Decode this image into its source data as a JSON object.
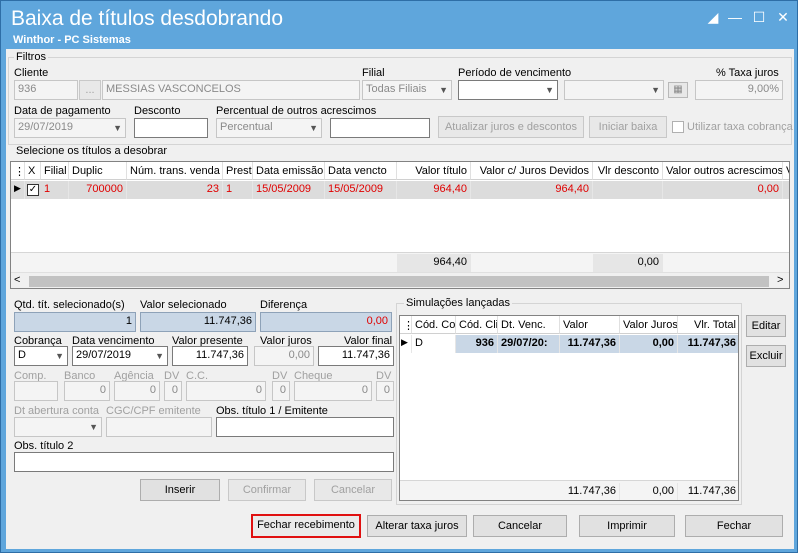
{
  "window": {
    "title": "Baixa de títulos desdobrando",
    "subtitle": "Winthor - PC Sistemas"
  },
  "filtros": {
    "group_label": "Filtros",
    "cliente_label": "Cliente",
    "cliente_code": "936",
    "cliente_lookup": "...",
    "cliente_name": "MESSIAS VASCONCELOS",
    "filial_label": "Filial",
    "filial_value": "Todas Filiais",
    "periodo_label": "Período de vencimento",
    "periodo_start": "",
    "periodo_end": "",
    "taxa_label": "% Taxa juros",
    "taxa_value": "9,00%",
    "data_pagamento_label": "Data de pagamento",
    "data_pagamento_value": "29/07/2019",
    "desconto_label": "Desconto",
    "desconto_value": "",
    "perc_outros_label": "Percentual de outros acrescimos",
    "perc_outros_select": "Percentual",
    "perc_outros_value": "",
    "atualizar_button": "Atualizar juros e descontos",
    "iniciar_button": "Iniciar baixa",
    "utilizar_taxa_label": "Utilizar taxa cobrança"
  },
  "titulos": {
    "group_label": "Selecione os títulos a desobrar",
    "columns": [
      "X",
      "Filial",
      "Duplic",
      "Núm. trans. venda",
      "Prest",
      "Data emissão",
      "Data vencto",
      "Valor título",
      "Valor c/ Juros Devidos",
      "Vlr desconto",
      "Valor outros acrescimos",
      "V"
    ],
    "rows": [
      {
        "filial": "1",
        "duplic": "700000",
        "num_trans": "23",
        "prest": "1",
        "data_emissao": "15/05/2009",
        "data_vencto": "15/05/2009",
        "valor_titulo": "964,40",
        "valor_juros": "964,40",
        "vlr_desconto": "",
        "valor_outros": "0,00"
      }
    ],
    "footer_valor_titulo": "964,40",
    "footer_vlr_desconto": "0,00"
  },
  "resumo": {
    "qtd_label": "Qtd. tít. selecionado(s)",
    "qtd_value": "1",
    "valor_sel_label": "Valor selecionado",
    "valor_sel_value": "11.747,36",
    "diferenca_label": "Diferença",
    "diferenca_value": "0,00"
  },
  "form": {
    "cobranca_label": "Cobrança",
    "cobranca_value": "D",
    "data_venc_label": "Data vencimento",
    "data_venc_value": "29/07/2019",
    "valor_presente_label": "Valor presente",
    "valor_presente_value": "11.747,36",
    "valor_juros_label": "Valor juros",
    "valor_juros_value": "0,00",
    "valor_final_label": "Valor final",
    "valor_final_value": "11.747,36",
    "comp_label": "Comp.",
    "banco_label": "Banco",
    "banco_value": "0",
    "agencia_label": "Agência",
    "agencia_value": "0",
    "dv_label": "DV",
    "dv1_value": "0",
    "cc_label": "C.C.",
    "cc_value": "0",
    "dv2_value": "0",
    "cheque_label": "Cheque",
    "cheque_value": "0",
    "dv3_value": "0",
    "dt_abertura_label": "Dt abertura conta",
    "cgc_label": "CGC/CPF emitente",
    "obs1_label": "Obs. título 1 / Emitente",
    "obs2_label": "Obs. título 2",
    "inserir_button": "Inserir",
    "confirmar_button": "Confirmar",
    "cancelar_button": "Cancelar"
  },
  "simulacoes": {
    "group_label": "Simulações lançadas",
    "columns": [
      "Cód. Co",
      "Cód. Cli",
      "Dt. Venc.",
      "Valor",
      "Valor Juros",
      "Vlr. Total"
    ],
    "rows": [
      {
        "cod_co": "D",
        "cod_cli": "936",
        "dt_venc": "29/07/20:",
        "valor": "11.747,36",
        "valor_juros": "0,00",
        "vlr_total": "11.747,36"
      }
    ],
    "footer_valor": "11.747,36",
    "footer_juros": "0,00",
    "footer_total": "11.747,36",
    "editar_button": "Editar",
    "excluir_button": "Excluir"
  },
  "bottom": {
    "fechar_recebimento": "Fechar recebimento",
    "alterar_taxa": "Alterar taxa juros",
    "cancelar": "Cancelar",
    "imprimir": "Imprimir",
    "fechar": "Fechar"
  }
}
